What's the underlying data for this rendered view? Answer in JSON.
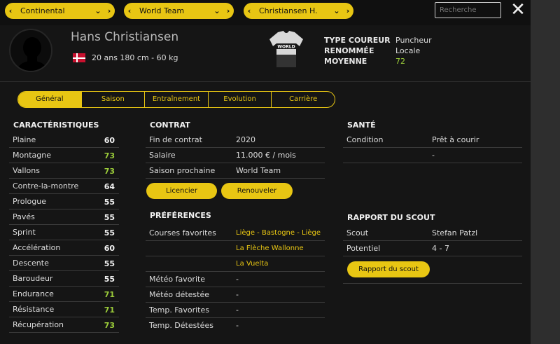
{
  "topbar": {
    "selector1": "Continental",
    "selector2": "World Team",
    "selector3": "Christiansen H.",
    "search_placeholder": "Recherche",
    "close_icon": "close-icon"
  },
  "rider": {
    "name": "Hans Christiansen",
    "country_flag": "denmark-flag",
    "info": "20 ans  180 cm - 60 kg",
    "jersey_text": "WORLD"
  },
  "attributes": [
    {
      "label": "TYPE COUREUR",
      "value": "Puncheur"
    },
    {
      "label": "RENOMMÉE",
      "value": "Locale"
    },
    {
      "label": "MOYENNE",
      "value": "72"
    }
  ],
  "tabs": [
    "Général",
    "Saison",
    "Entraînement",
    "Evolution",
    "Carrière"
  ],
  "active_tab": "Général",
  "characteristics": {
    "title": "CARACTÉRISTIQUES",
    "rows": [
      {
        "label": "Plaine",
        "value": "60",
        "color": "white"
      },
      {
        "label": "Montagne",
        "value": "73",
        "color": "green"
      },
      {
        "label": "Vallons",
        "value": "73",
        "color": "green"
      },
      {
        "label": "Contre-la-montre",
        "value": "64",
        "color": "white"
      },
      {
        "label": "Prologue",
        "value": "55",
        "color": "white"
      },
      {
        "label": "Pavés",
        "value": "55",
        "color": "white"
      },
      {
        "label": "Sprint",
        "value": "55",
        "color": "white"
      },
      {
        "label": "Accélération",
        "value": "60",
        "color": "white"
      },
      {
        "label": "Descente",
        "value": "55",
        "color": "white"
      },
      {
        "label": "Baroudeur",
        "value": "55",
        "color": "white"
      },
      {
        "label": "Endurance",
        "value": "71",
        "color": "green"
      },
      {
        "label": "Résistance",
        "value": "71",
        "color": "green"
      },
      {
        "label": "Récupération",
        "value": "73",
        "color": "green"
      }
    ]
  },
  "contract": {
    "title": "CONTRAT",
    "rows": [
      {
        "label": "Fin de contrat",
        "value": "2020"
      },
      {
        "label": "Salaire",
        "value": "11.000 € / mois"
      },
      {
        "label": "Saison prochaine",
        "value": "World Team"
      }
    ],
    "fire_button": "Licencier",
    "renew_button": "Renouveler"
  },
  "preferences": {
    "title": "PRÉFÉRENCES",
    "favorite_races_label": "Courses favorites",
    "favorite_races": [
      "Liège - Bastogne - Liège",
      "La Flèche Wallonne",
      "La Vuelta"
    ],
    "rows": [
      {
        "label": "Météo favorite",
        "value": "-"
      },
      {
        "label": "Météo détestée",
        "value": "-"
      },
      {
        "label": "Temp. Favorites",
        "value": "-"
      },
      {
        "label": "Temp. Détestées",
        "value": "-"
      }
    ]
  },
  "health": {
    "title": "SANTÉ",
    "rows": [
      {
        "label": "Condition",
        "value": "Prêt à courir"
      },
      {
        "label": "",
        "value": "-"
      }
    ]
  },
  "scout": {
    "title": "RAPPORT DU SCOUT",
    "rows": [
      {
        "label": "Scout",
        "value": "Stefan Patzl"
      },
      {
        "label": "Potentiel",
        "value": "4 - 7"
      }
    ],
    "report_button": "Rapport du scout"
  },
  "colors": {
    "accent": "#e8c613",
    "green": "#9ccd3a",
    "background": "#151515"
  }
}
